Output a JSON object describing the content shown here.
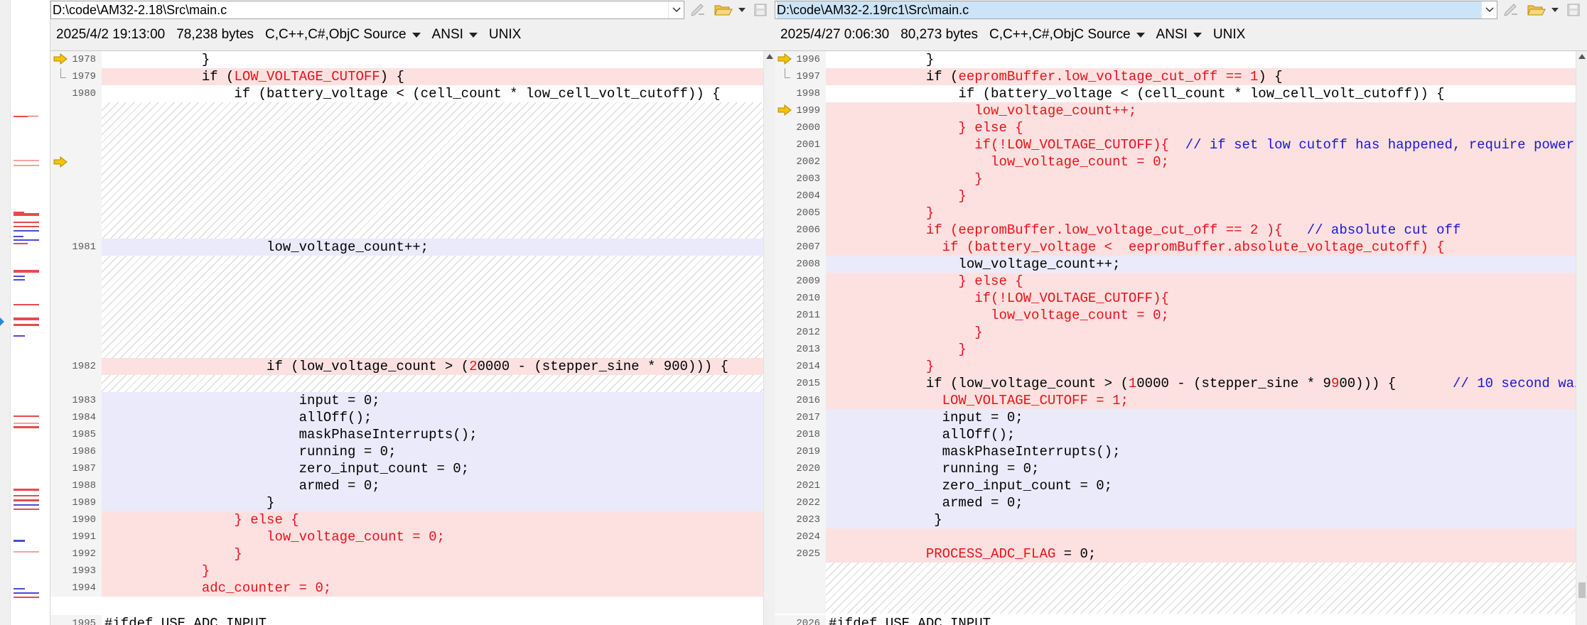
{
  "left": {
    "path": "D:\\code\\AM32-2.18\\Src\\main.c",
    "date": "2025/4/2 19:13:00",
    "size": "78,238 bytes",
    "format": "C,C++,C#,ObjC Source",
    "encoding": "ANSI",
    "eol": "UNIX"
  },
  "right": {
    "path": "D:\\code\\AM32-2.19rc1\\Src\\main.c",
    "date": "2025/4/27 0:06:30",
    "size": "80,273 bytes",
    "format": "C,C++,C#,ObjC Source",
    "encoding": "ANSI",
    "eol": "UNIX"
  },
  "icons": {
    "dropdown": "chevron-down-icon",
    "edit": "edit-icon",
    "open": "folder-open-icon",
    "save": "save-icon",
    "diff_marker": "diff-arrow-icon"
  },
  "colors": {
    "deleted_bg": "#fde1e1",
    "deleted_text": "#e8121a",
    "changed_bg": "#ebeafb",
    "comment": "#1a17d8",
    "marker": "#f0b400"
  }
}
